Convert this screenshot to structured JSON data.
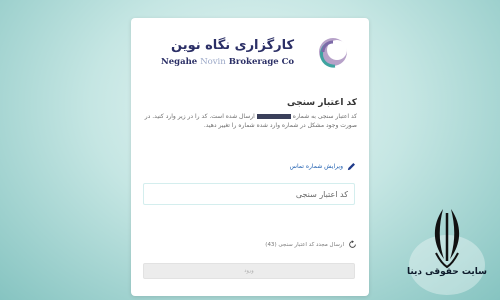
{
  "brand": {
    "name_fa": "کارگزاری نگاه نوین",
    "name_en_dark": "Negahe",
    "name_en_light": "Novin",
    "name_en_rest": "Brokerage Co"
  },
  "verify": {
    "title": "کد اعتبار سنجی",
    "description_1": "کد اعتبار سنجی به شماره",
    "description_2": "ارسال شده است. کد را در زیر وارد کنید. در صورت وجود مشکل در شماره وارد شده شماره را تغییر دهید.",
    "edit_link": "ویرایش شماره تماس",
    "input_placeholder": "کد اعتبار سنجی",
    "resend": "ارسال مجدد کد اعتبار سنجی (43)",
    "submit": "ورود"
  },
  "watermark": {
    "site_name": "سایت حقوقی دینا"
  },
  "colors": {
    "brand_navy": "#2b2f66",
    "link_blue": "#1f5fb0",
    "button_disabled": "#ececec"
  }
}
